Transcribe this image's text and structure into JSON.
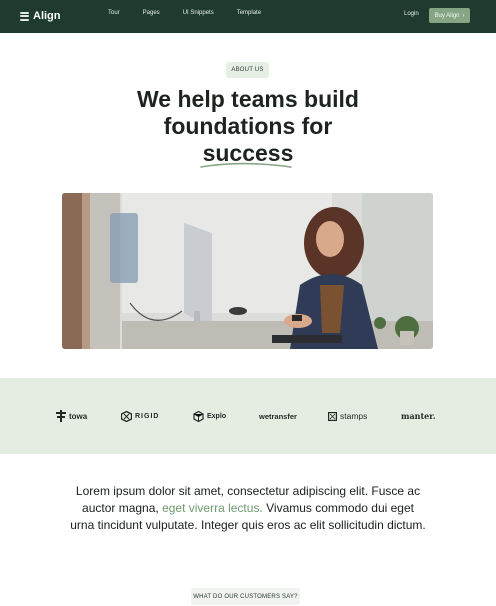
{
  "nav": {
    "logo_text": "Align",
    "links": [
      "Tour",
      "Pages",
      "UI Snippets",
      "Template"
    ],
    "login": "Login",
    "buy_label": "Buy Align",
    "buy_chevron": "›"
  },
  "hero": {
    "badge": "ABOUT US",
    "title_line1": "We help teams build",
    "title_line2": "foundations for",
    "title_line3": "success"
  },
  "logos": {
    "items": [
      "towa",
      "RIGID",
      "Explo",
      "wetransfer",
      "stamps",
      "manter."
    ]
  },
  "about": {
    "text_before": "Lorem ipsum dolor sit amet, consectetur adipiscing elit. Fusce ac auctor magna, ",
    "text_accent": "eget viverra lectus.",
    "text_after": " Vivamus commodo dui eget urna tincidunt vulputate. Integer quis eros ac elit sollicitudin dictum."
  },
  "testimonials": {
    "badge": "WHAT DO OUR CUSTOMERS SAY?"
  },
  "colors": {
    "nav_bg": "#1f3b30",
    "accent": "#86a585",
    "band_bg": "#e5ede3"
  }
}
